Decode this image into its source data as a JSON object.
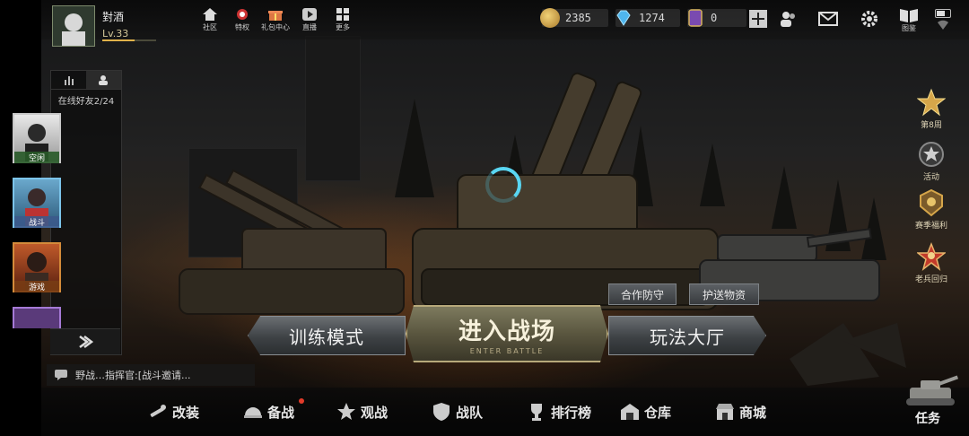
{
  "player": {
    "name": "對酒",
    "level": "Lv.33"
  },
  "top_nav": [
    {
      "label": "社区",
      "icon": "home-icon"
    },
    {
      "label": "特权",
      "icon": "privilege-icon"
    },
    {
      "label": "礼包中心",
      "icon": "gift-icon"
    },
    {
      "label": "直播",
      "icon": "live-icon"
    },
    {
      "label": "更多",
      "icon": "more-icon"
    }
  ],
  "resources": {
    "gold": "2385",
    "diamond": "1274",
    "cards": "0"
  },
  "top_right": {
    "guide_label": "图鉴"
  },
  "friends": {
    "online_text": "在线好友2/24",
    "items": [
      {
        "tag": "空闲"
      },
      {
        "tag": "战斗"
      },
      {
        "tag": "游戏"
      },
      {
        "tag": ""
      }
    ]
  },
  "chat": {
    "message": "野战…指挥官:[战斗邀请..."
  },
  "right_side": [
    {
      "label": "第8周",
      "icon": "star-medal-icon"
    },
    {
      "label": "活动",
      "icon": "activity-star-icon"
    },
    {
      "label": "赛季福利",
      "icon": "season-badge-icon"
    },
    {
      "label": "老兵回归",
      "icon": "veteran-icon"
    }
  ],
  "modes": {
    "coop_label": "合作防守",
    "escort_label": "护送物资",
    "training_label": "训练模式",
    "enter_label": "进入战场",
    "enter_sub": "ENTER BATTLE",
    "lobby_label": "玩法大厅"
  },
  "bottom_nav": [
    {
      "label": "改装",
      "icon": "wrench-icon"
    },
    {
      "label": "备战",
      "icon": "helmet-icon"
    },
    {
      "label": "观战",
      "icon": "watch-star-icon"
    },
    {
      "label": "战队",
      "icon": "shield-icon"
    },
    {
      "label": "排行榜",
      "icon": "trophy-icon"
    },
    {
      "label": "仓库",
      "icon": "warehouse-icon"
    },
    {
      "label": "商城",
      "icon": "shop-icon"
    }
  ],
  "task_label": "任务",
  "colors": {
    "accent_gold": "#e0b24a",
    "loading_cyan": "#59d6f2",
    "badge_red": "#e23b2a"
  }
}
